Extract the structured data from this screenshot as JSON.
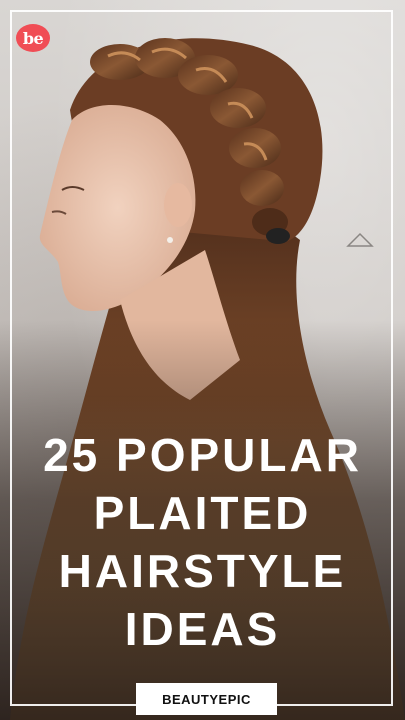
{
  "logo": {
    "text": "be",
    "color": "#f04d55"
  },
  "headline": {
    "lines": [
      "25 POPULAR",
      "PLAITED",
      "HAIRSTYLE",
      "IDEAS"
    ]
  },
  "brand": {
    "label": "BEAUTYEPIC"
  },
  "colors": {
    "frame": "#ffffff",
    "text": "#ffffff",
    "brand_bg": "#ffffff"
  }
}
